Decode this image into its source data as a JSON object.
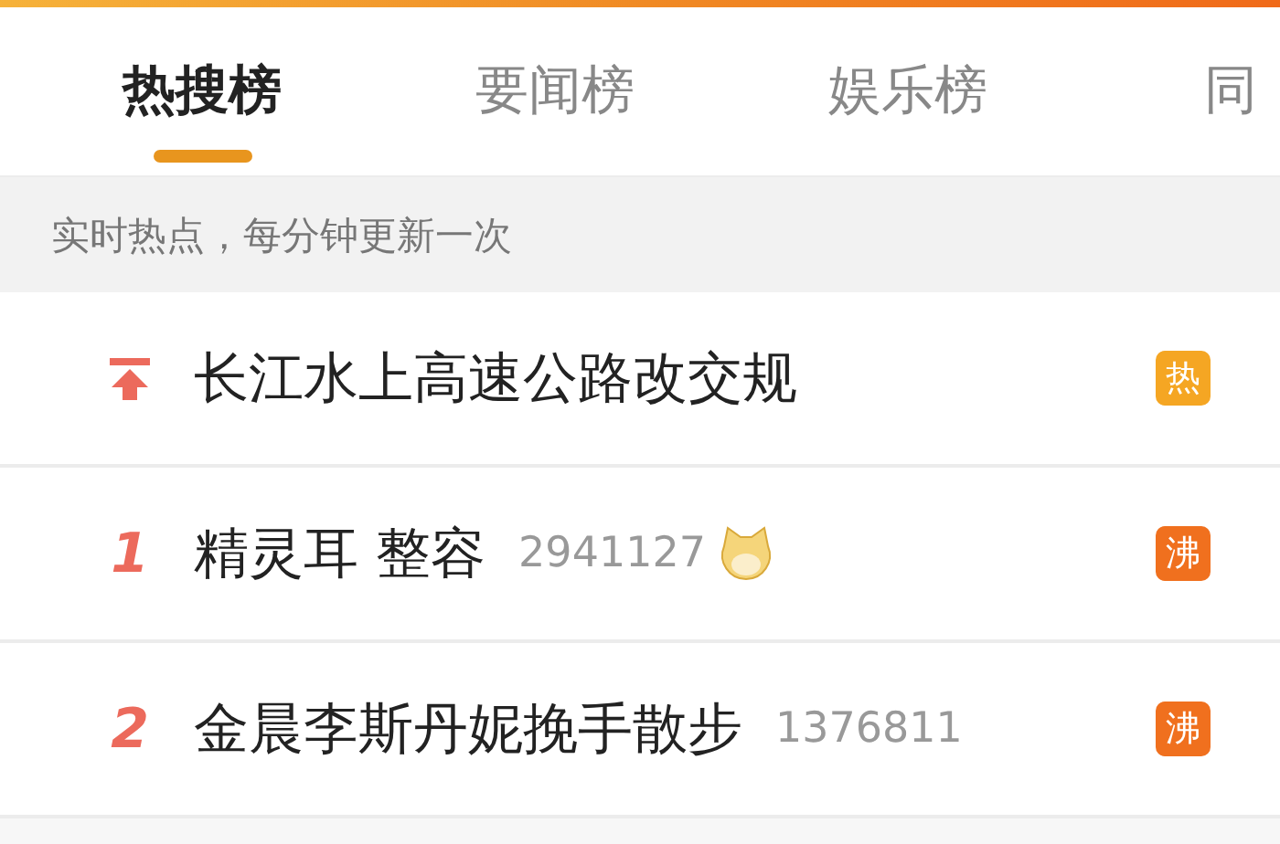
{
  "tabs": [
    {
      "label": "热搜榜",
      "selected": true
    },
    {
      "label": "要闻榜",
      "selected": false
    },
    {
      "label": "娱乐榜",
      "selected": false
    },
    {
      "label": "同",
      "selected": false
    }
  ],
  "subtitle": "实时热点，每分钟更新一次",
  "rows": [
    {
      "kind": "pinned",
      "title": "长江水上高速公路改交规",
      "badge": "热",
      "color": "#f5a623",
      "emoji": false
    },
    {
      "kind": "ranked",
      "rank": "1",
      "title": "精灵耳 整容",
      "count": "2941127",
      "emoji": true,
      "badge": "沸",
      "color": "#f0701e"
    },
    {
      "kind": "ranked",
      "rank": "2",
      "title": "金晨李斯丹妮挽手散步",
      "count": "1376811",
      "emoji": false,
      "badge": "沸",
      "color": "#f0701e"
    }
  ]
}
